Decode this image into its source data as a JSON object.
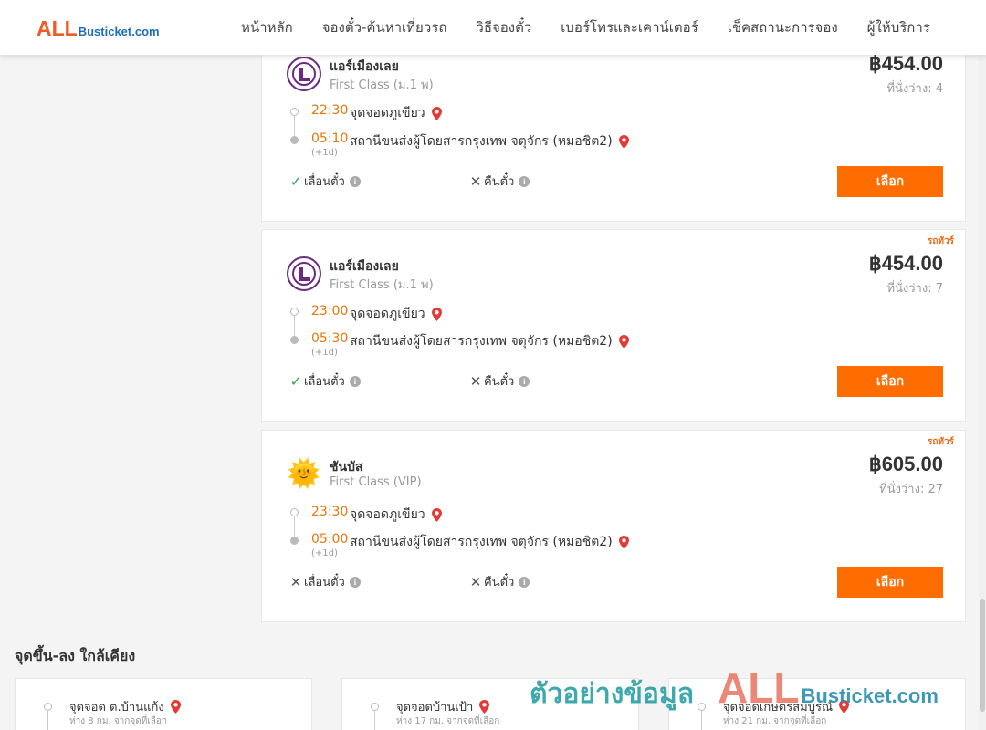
{
  "header": {
    "logo_all": "ALL",
    "logo_rest": "Busticket.com",
    "nav": [
      "หน้าหลัก",
      "จองตั๋ว-ค้นหาเที่ยวรถ",
      "วิธีจองตั๋ว",
      "เบอร์โทรและเคาน์เตอร์",
      "เช็คสถานะการจอง",
      "ผู้ให้บริการ"
    ]
  },
  "trips": [
    {
      "tag": "",
      "operator": "แอร์เมืองเลย",
      "bus_class": "First Class (ม.1 พ)",
      "price": "฿454.00",
      "seats": "ที่นั่งว่าง: 4",
      "depart_time": "22:30",
      "depart_stop": "จุดจอดภูเขียว",
      "arrive_time": "05:10",
      "arrive_stop": "สถานีขนส่งผู้โดยสารกรุงเทพ จตุจักร (หมอชิต2)",
      "plus_day": "(+1d)",
      "change": "เลื่อนตั๋ว",
      "change_allowed": true,
      "refund": "คืนตั๋ว",
      "refund_allowed": false,
      "button": "เลือก"
    },
    {
      "tag": "รถทัวร์",
      "operator": "แอร์เมืองเลย",
      "bus_class": "First Class (ม.1 พ)",
      "price": "฿454.00",
      "seats": "ที่นั่งว่าง: 7",
      "depart_time": "23:00",
      "depart_stop": "จุดจอดภูเขียว",
      "arrive_time": "05:30",
      "arrive_stop": "สถานีขนส่งผู้โดยสารกรุงเทพ จตุจักร (หมอชิต2)",
      "plus_day": "(+1d)",
      "change": "เลื่อนตั๋ว",
      "change_allowed": true,
      "refund": "คืนตั๋ว",
      "refund_allowed": false,
      "button": "เลือก"
    },
    {
      "tag": "รถทัวร์",
      "operator": "ชันบัส",
      "bus_class": "First Class (VIP)",
      "price": "฿605.00",
      "seats": "ที่นั่งว่าง: 27",
      "depart_time": "23:30",
      "depart_stop": "จุดจอดภูเขียว",
      "arrive_time": "05:00",
      "arrive_stop": "สถานีขนส่งผู้โดยสารกรุงเทพ จตุจักร (หมอชิต2)",
      "plus_day": "(+1d)",
      "change": "เลื่อนตั๋ว",
      "change_allowed": false,
      "refund": "คืนตั๋ว",
      "refund_allowed": false,
      "button": "เลือก"
    }
  ],
  "nearby": {
    "title": "จุดขึ้น-ลง ใกล้เคียง",
    "items": [
      {
        "name": "จุดจอด ต.บ้านแก้ง",
        "distance": "ห่าง 8 กม. จากจุดที่เลือก"
      },
      {
        "name": "จุดจอดบ้านเป้า",
        "distance": "ห่าง 17 กม. จากจุดที่เลือก"
      },
      {
        "name": "จุดจอดเกษตรสมบูรณ์",
        "distance": "ห่าง 21 กม. จากจุดที่เลือก"
      }
    ]
  },
  "watermark": {
    "thai": "ตัวอย่างข้อมูล",
    "all": "ALL",
    "rest": "Busticket.com"
  },
  "colors": {
    "accent": "#ff6c00",
    "time": "#e8770e",
    "logo_orange": "#f15a24",
    "logo_blue": "#1d6fb8",
    "check": "#2aa44a"
  },
  "icons": {
    "pin": "map-pin-icon",
    "check": "check-icon",
    "cross": "cross-icon",
    "info": "info-icon"
  }
}
